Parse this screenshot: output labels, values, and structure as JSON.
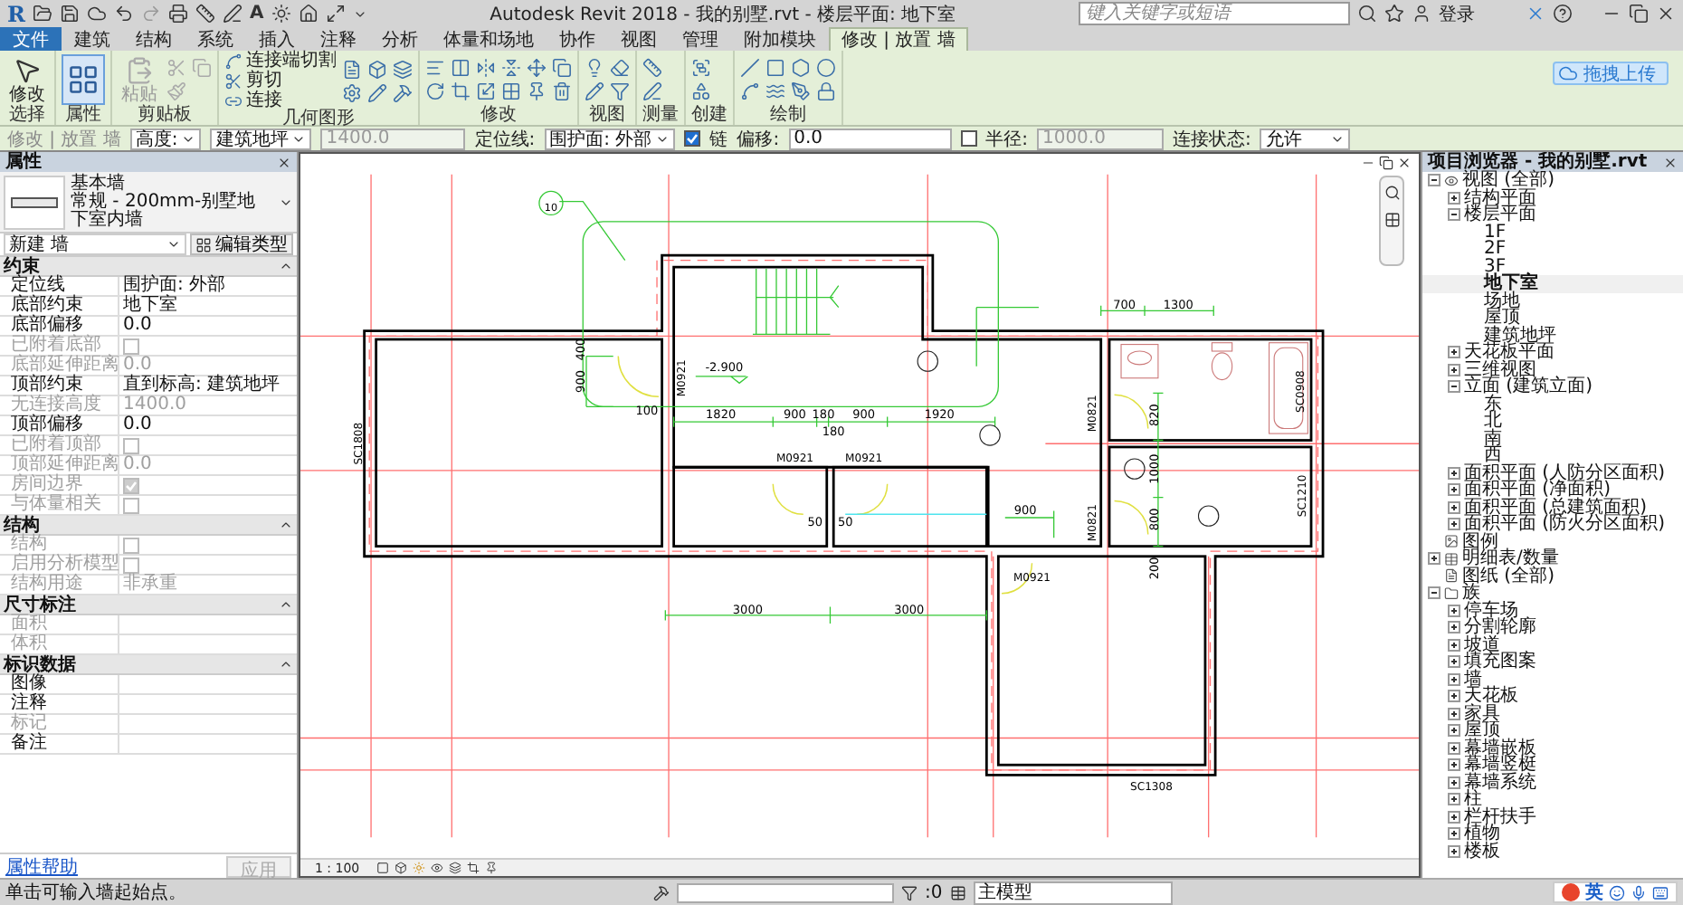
{
  "title_bar": {
    "logo": "R",
    "quick_access_text": "A",
    "title": "Autodesk Revit 2018 -   我的别墅.rvt - 楼层平面: 地下室",
    "search": {
      "placeholder": "键入关键字或短语"
    },
    "sign_in": "登录"
  },
  "ribbon_tabs": [
    {
      "label": "文件",
      "kind": "file",
      "selected": false
    },
    {
      "label": "建筑",
      "kind": "tab",
      "selected": false
    },
    {
      "label": "结构",
      "kind": "tab",
      "selected": false
    },
    {
      "label": "系统",
      "kind": "tab",
      "selected": false
    },
    {
      "label": "插入",
      "kind": "tab",
      "selected": false
    },
    {
      "label": "注释",
      "kind": "tab",
      "selected": false
    },
    {
      "label": "分析",
      "kind": "tab",
      "selected": false
    },
    {
      "label": "体量和场地",
      "kind": "tab",
      "selected": false
    },
    {
      "label": "协作",
      "kind": "tab",
      "selected": false
    },
    {
      "label": "视图",
      "kind": "tab",
      "selected": false
    },
    {
      "label": "管理",
      "kind": "tab",
      "selected": false
    },
    {
      "label": "附加模块",
      "kind": "tab",
      "selected": false
    },
    {
      "label": "修改 | 放置 墙",
      "kind": "tab",
      "selected": true
    }
  ],
  "upload_button": "拖拽上传",
  "ribbon_panels": [
    {
      "label": "选择",
      "kind": "select",
      "buttons": [
        "修改"
      ]
    },
    {
      "label": "属性",
      "kind": "properties"
    },
    {
      "label": "剪贴板",
      "kind": "clipboard",
      "buttons": [
        "粘贴"
      ]
    },
    {
      "label": "几何图形",
      "kind": "geometry",
      "buttons": [
        "连接端切割",
        "剪切",
        "连接"
      ]
    },
    {
      "label": "修改",
      "kind": "modify"
    },
    {
      "label": "视图",
      "kind": "view"
    },
    {
      "label": "测量",
      "kind": "measure"
    },
    {
      "label": "创建",
      "kind": "create"
    },
    {
      "label": "绘制",
      "kind": "draw"
    }
  ],
  "options_bar": {
    "mode": "修改 | 放置 墙",
    "height_label": "高度:",
    "height_ref": "建筑地坪",
    "height_value": "1400.0",
    "location_label": "定位线:",
    "location_value": "围护面: 外部",
    "chain": {
      "label": "链",
      "checked": true
    },
    "offset_label": "偏移:",
    "offset_value": "0.0",
    "radius": {
      "label": "半径:",
      "checked": false
    },
    "radius_value": "1000.0",
    "join_label": "连接状态:",
    "join_value": "允许"
  },
  "properties": {
    "title": "属性",
    "type_family": "基本墙",
    "type_name": "常规 - 200mm-别墅地下室内墙",
    "instance_selector": "新建 墙",
    "edit_type": "编辑类型",
    "sections": [
      {
        "title": "约束",
        "rows": [
          {
            "label": "定位线",
            "kind": "text",
            "value": "围护面: 外部",
            "disabled": false
          },
          {
            "label": "底部约束",
            "kind": "text",
            "value": "地下室",
            "disabled": false
          },
          {
            "label": "底部偏移",
            "kind": "text",
            "value": "0.0",
            "disabled": false
          },
          {
            "label": "已附着底部",
            "kind": "check",
            "checked": false,
            "disabled": true
          },
          {
            "label": "底部延伸距离",
            "kind": "text",
            "value": "0.0",
            "disabled": true
          },
          {
            "label": "顶部约束",
            "kind": "text",
            "value": "直到标高: 建筑地坪",
            "disabled": false
          },
          {
            "label": "无连接高度",
            "kind": "text",
            "value": "1400.0",
            "disabled": true
          },
          {
            "label": "顶部偏移",
            "kind": "text",
            "value": "0.0",
            "disabled": false
          },
          {
            "label": "已附着顶部",
            "kind": "check",
            "checked": false,
            "disabled": true
          },
          {
            "label": "顶部延伸距离",
            "kind": "text",
            "value": "0.0",
            "disabled": true
          },
          {
            "label": "房间边界",
            "kind": "check",
            "checked": true,
            "disabled": true
          },
          {
            "label": "与体量相关",
            "kind": "check",
            "checked": false,
            "disabled": true
          }
        ]
      },
      {
        "title": "结构",
        "rows": [
          {
            "label": "结构",
            "kind": "check",
            "checked": false,
            "disabled": true
          },
          {
            "label": "启用分析模型",
            "kind": "check",
            "checked": false,
            "disabled": true
          },
          {
            "label": "结构用途",
            "kind": "text",
            "value": "非承重",
            "disabled": true
          }
        ]
      },
      {
        "title": "尺寸标注",
        "rows": [
          {
            "label": "面积",
            "kind": "text",
            "disabled": true
          },
          {
            "label": "体积",
            "kind": "text",
            "disabled": true
          }
        ]
      },
      {
        "title": "标识数据",
        "rows": [
          {
            "label": "图像",
            "kind": "text",
            "disabled": false
          },
          {
            "label": "注释",
            "kind": "text",
            "disabled": false
          },
          {
            "label": "标记",
            "kind": "text",
            "disabled": true
          },
          {
            "label": "备注",
            "kind": "text",
            "disabled": false
          }
        ]
      }
    ],
    "help_link": "属性帮助",
    "apply": "应用"
  },
  "canvas": {
    "scale": "1 : 100",
    "annotations": [
      {
        "text": "10",
        "kind": "callout"
      },
      {
        "text": "700",
        "kind": "dimension"
      },
      {
        "text": "1300",
        "kind": "dimension"
      },
      {
        "text": "-2.900",
        "kind": "level"
      },
      {
        "text": "400",
        "kind": "dimension"
      },
      {
        "text": "900",
        "kind": "dimension"
      },
      {
        "text": "SC1808",
        "kind": "window-tag"
      },
      {
        "text": "M0921",
        "kind": "door-tag"
      },
      {
        "text": "100",
        "kind": "dimension"
      },
      {
        "text": "1820",
        "kind": "dimension"
      },
      {
        "text": "900",
        "kind": "dimension"
      },
      {
        "text": "180",
        "kind": "dimension"
      },
      {
        "text": "900",
        "kind": "dimension"
      },
      {
        "text": "1920",
        "kind": "dimension"
      },
      {
        "text": "180",
        "kind": "dimension"
      },
      {
        "text": "M0921",
        "kind": "door-tag"
      },
      {
        "text": "M0921",
        "kind": "door-tag"
      },
      {
        "text": "M0821",
        "kind": "door-tag"
      },
      {
        "text": "M0821",
        "kind": "door-tag"
      },
      {
        "text": "SC0908",
        "kind": "window-tag"
      },
      {
        "text": "SC1210",
        "kind": "window-tag"
      },
      {
        "text": "820",
        "kind": "dimension"
      },
      {
        "text": "1000",
        "kind": "dimension"
      },
      {
        "text": "800",
        "kind": "dimension"
      },
      {
        "text": "200",
        "kind": "dimension"
      },
      {
        "text": "900",
        "kind": "dimension"
      },
      {
        "text": "50",
        "kind": "dimension"
      },
      {
        "text": "50",
        "kind": "dimension"
      },
      {
        "text": "M0921",
        "kind": "door-tag"
      },
      {
        "text": "3000",
        "kind": "dimension"
      },
      {
        "text": "3000",
        "kind": "dimension"
      },
      {
        "text": "SC1308",
        "kind": "window-tag"
      }
    ]
  },
  "browser": {
    "title": "项目浏览器 - 我的别墅.rvt",
    "tree": [
      {
        "label": "视图 (全部)",
        "expanded": true,
        "selected": false,
        "children": [
          {
            "label": "结构平面",
            "expanded": false,
            "selected": false
          },
          {
            "label": "楼层平面",
            "expanded": true,
            "selected": false,
            "children": [
              {
                "label": "1F",
                "selected": false
              },
              {
                "label": "2F",
                "selected": false
              },
              {
                "label": "3F",
                "selected": false
              },
              {
                "label": "地下室",
                "selected": true
              },
              {
                "label": "场地",
                "selected": false
              },
              {
                "label": "屋顶",
                "selected": false
              },
              {
                "label": "建筑地坪",
                "selected": false
              }
            ]
          },
          {
            "label": "天花板平面",
            "expanded": false,
            "selected": false
          },
          {
            "label": "三维视图",
            "expanded": false,
            "selected": false
          },
          {
            "label": "立面 (建筑立面)",
            "expanded": true,
            "selected": false,
            "children": [
              {
                "label": "东",
                "selected": false
              },
              {
                "label": "北",
                "selected": false
              },
              {
                "label": "南",
                "selected": false
              },
              {
                "label": "西",
                "selected": false
              }
            ]
          },
          {
            "label": "面积平面 (人防分区面积)",
            "expanded": false,
            "selected": false
          },
          {
            "label": "面积平面 (净面积)",
            "expanded": false,
            "selected": false
          },
          {
            "label": "面积平面 (总建筑面积)",
            "expanded": false,
            "selected": false
          },
          {
            "label": "面积平面 (防火分区面积)",
            "expanded": false,
            "selected": false
          }
        ]
      },
      {
        "label": "图例",
        "selected": false
      },
      {
        "label": "明细表/数量",
        "expanded": false,
        "selected": false
      },
      {
        "label": "图纸 (全部)",
        "selected": false
      },
      {
        "label": "族",
        "expanded": true,
        "selected": false,
        "children": [
          {
            "label": "停车场",
            "expanded": false,
            "selected": false
          },
          {
            "label": "分割轮廓",
            "expanded": false,
            "selected": false
          },
          {
            "label": "坡道",
            "expanded": false,
            "selected": false
          },
          {
            "label": "填充图案",
            "expanded": false,
            "selected": false
          },
          {
            "label": "墙",
            "expanded": false,
            "selected": false
          },
          {
            "label": "天花板",
            "expanded": false,
            "selected": false
          },
          {
            "label": "家具",
            "expanded": false,
            "selected": false
          },
          {
            "label": "屋顶",
            "expanded": false,
            "selected": false
          },
          {
            "label": "幕墙嵌板",
            "expanded": false,
            "selected": false
          },
          {
            "label": "幕墙竖梃",
            "expanded": false,
            "selected": false
          },
          {
            "label": "幕墙系统",
            "expanded": false,
            "selected": false
          },
          {
            "label": "柱",
            "expanded": false,
            "selected": false
          },
          {
            "label": "栏杆扶手",
            "expanded": false,
            "selected": false
          },
          {
            "label": "植物",
            "expanded": false,
            "selected": false
          },
          {
            "label": "楼板",
            "expanded": false,
            "selected": false
          }
        ]
      }
    ]
  },
  "status_bar": {
    "message": "单击可输入墙起始点。",
    "selection_count": ":0",
    "workset": "主模型",
    "ime_mode": "英"
  }
}
